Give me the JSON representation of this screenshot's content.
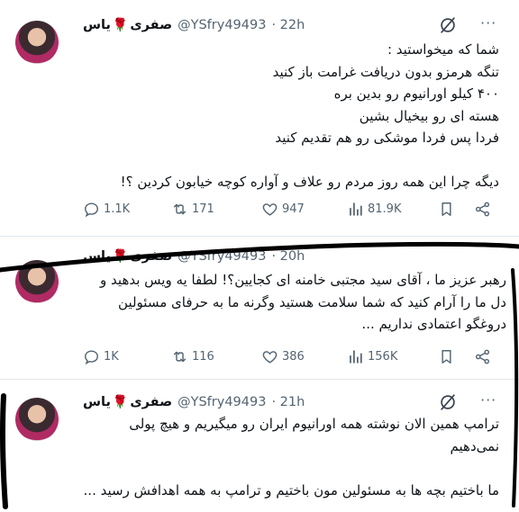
{
  "tweets": [
    {
      "name": "یاس",
      "rose": "🌹",
      "name2": "صفری",
      "handle": "@YSfry49493",
      "time": "· 22h",
      "text": "شما که میخواستید :\nتنگه هرمزو بدون دریافت غرامت باز کنید\n۴۰۰ کیلو اورانیوم رو بدین بره\nهسته ای رو بیخیال بشین\nفردا پس فردا موشکی رو هم تقدیم کنید\n\nدیگه چرا این همه روز مردم رو علاف و آواره کوچه خیابون کردین ؟!",
      "replies": "1.1K",
      "reposts": "171",
      "likes": "947",
      "views": "81.9K"
    },
    {
      "name": "یاس",
      "rose": "🌹",
      "name2": "صفری",
      "handle": "@YSfry49493",
      "time": "· 20h",
      "text": "رهبر عزیز ما ، آقای سید مجتبی خامنه ای کجایین؟! لطفا یه ویس بدهید و\nدل ما را آرام کنید که شما سلامت هستید وگرنه ما به حرفای مسئولین\nدروغگو اعتمادی نداریم ...",
      "replies": "1K",
      "reposts": "116",
      "likes": "386",
      "views": "156K"
    },
    {
      "name": "یاس",
      "rose": "🌹",
      "name2": "صفری",
      "handle": "@YSfry49493",
      "time": "· 21h",
      "text": "ترامپ همین الان نوشته همه اورانیوم ایران رو میگیریم و هیچ پولی\nنمی‌دهیم\n\nما باختیم بچه ها به مسئولین مون باختیم و ترامپ به همه اهدافش رسید ..."
    }
  ],
  "colors": {
    "rose": "#c8102e",
    "muted": "#536471",
    "border": "#e4e7ea"
  },
  "icons": [
    "grok-icon",
    "more-icon",
    "reply-icon",
    "repost-icon",
    "like-icon",
    "views-icon",
    "bookmark-icon",
    "share-icon"
  ]
}
